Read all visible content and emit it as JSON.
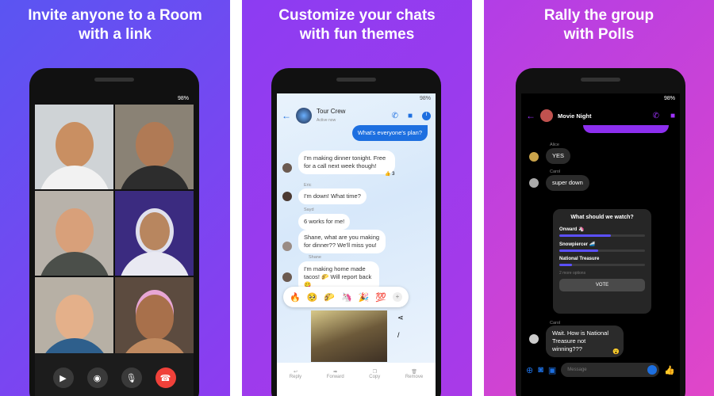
{
  "panels": [
    {
      "title_line1": "Invite anyone to a Room",
      "title_line2": "with a link"
    },
    {
      "title_line1": "Customize your chats",
      "title_line2": "with fun themes"
    },
    {
      "title_line1": "Rally the group",
      "title_line2": "with Polls"
    }
  ],
  "status": {
    "battery": "98%"
  },
  "room": {
    "controls": [
      "video-icon",
      "camera-flip-icon",
      "mic-icon",
      "end-call-icon"
    ],
    "end_color": "#f0413a"
  },
  "themes": {
    "chat_name": "Tour Crew",
    "chat_subtitle": "Active now",
    "messages": [
      {
        "text": "What's everyone's plan?",
        "outgoing": true
      },
      {
        "text": "I'm making dinner tonight. Free for a call next week though!",
        "reaction": "👍 3"
      },
      {
        "sender": "Eric",
        "text": "I'm down! What time?"
      },
      {
        "sender": "Sayd",
        "text": "6 works for me!"
      },
      {
        "text": "Shane, what are you making for dinner?? We'll miss you!"
      },
      {
        "sender": "Shane",
        "text": "I'm making home made tacos! 🌮 Will report back😋"
      }
    ],
    "reactions": [
      "🔥",
      "🥺",
      "🌮",
      "🦄",
      "🎉",
      "💯",
      "+"
    ],
    "actions": [
      "Reply",
      "Forward",
      "Copy",
      "Remove"
    ],
    "accent": "#1d6fe0"
  },
  "polls": {
    "chat_name": "Movie Night",
    "messages": [
      {
        "sender": "Alice",
        "text": "YES"
      },
      {
        "sender": "Carol",
        "text": "super down"
      },
      {
        "sender": "Carol",
        "text": "Wait. How is National Treasure not winning???"
      }
    ],
    "poll": {
      "question": "What should we watch?",
      "options": [
        {
          "label": "Onward 🦄",
          "share": 0.6
        },
        {
          "label": "Snowpiercer 🚄",
          "share": 0.45
        },
        {
          "label": "National Treasure",
          "share": 0.15
        }
      ],
      "more": "2 more options",
      "vote": "VOTE"
    },
    "composer_placeholder": "Message",
    "accent": "#a033ff"
  }
}
